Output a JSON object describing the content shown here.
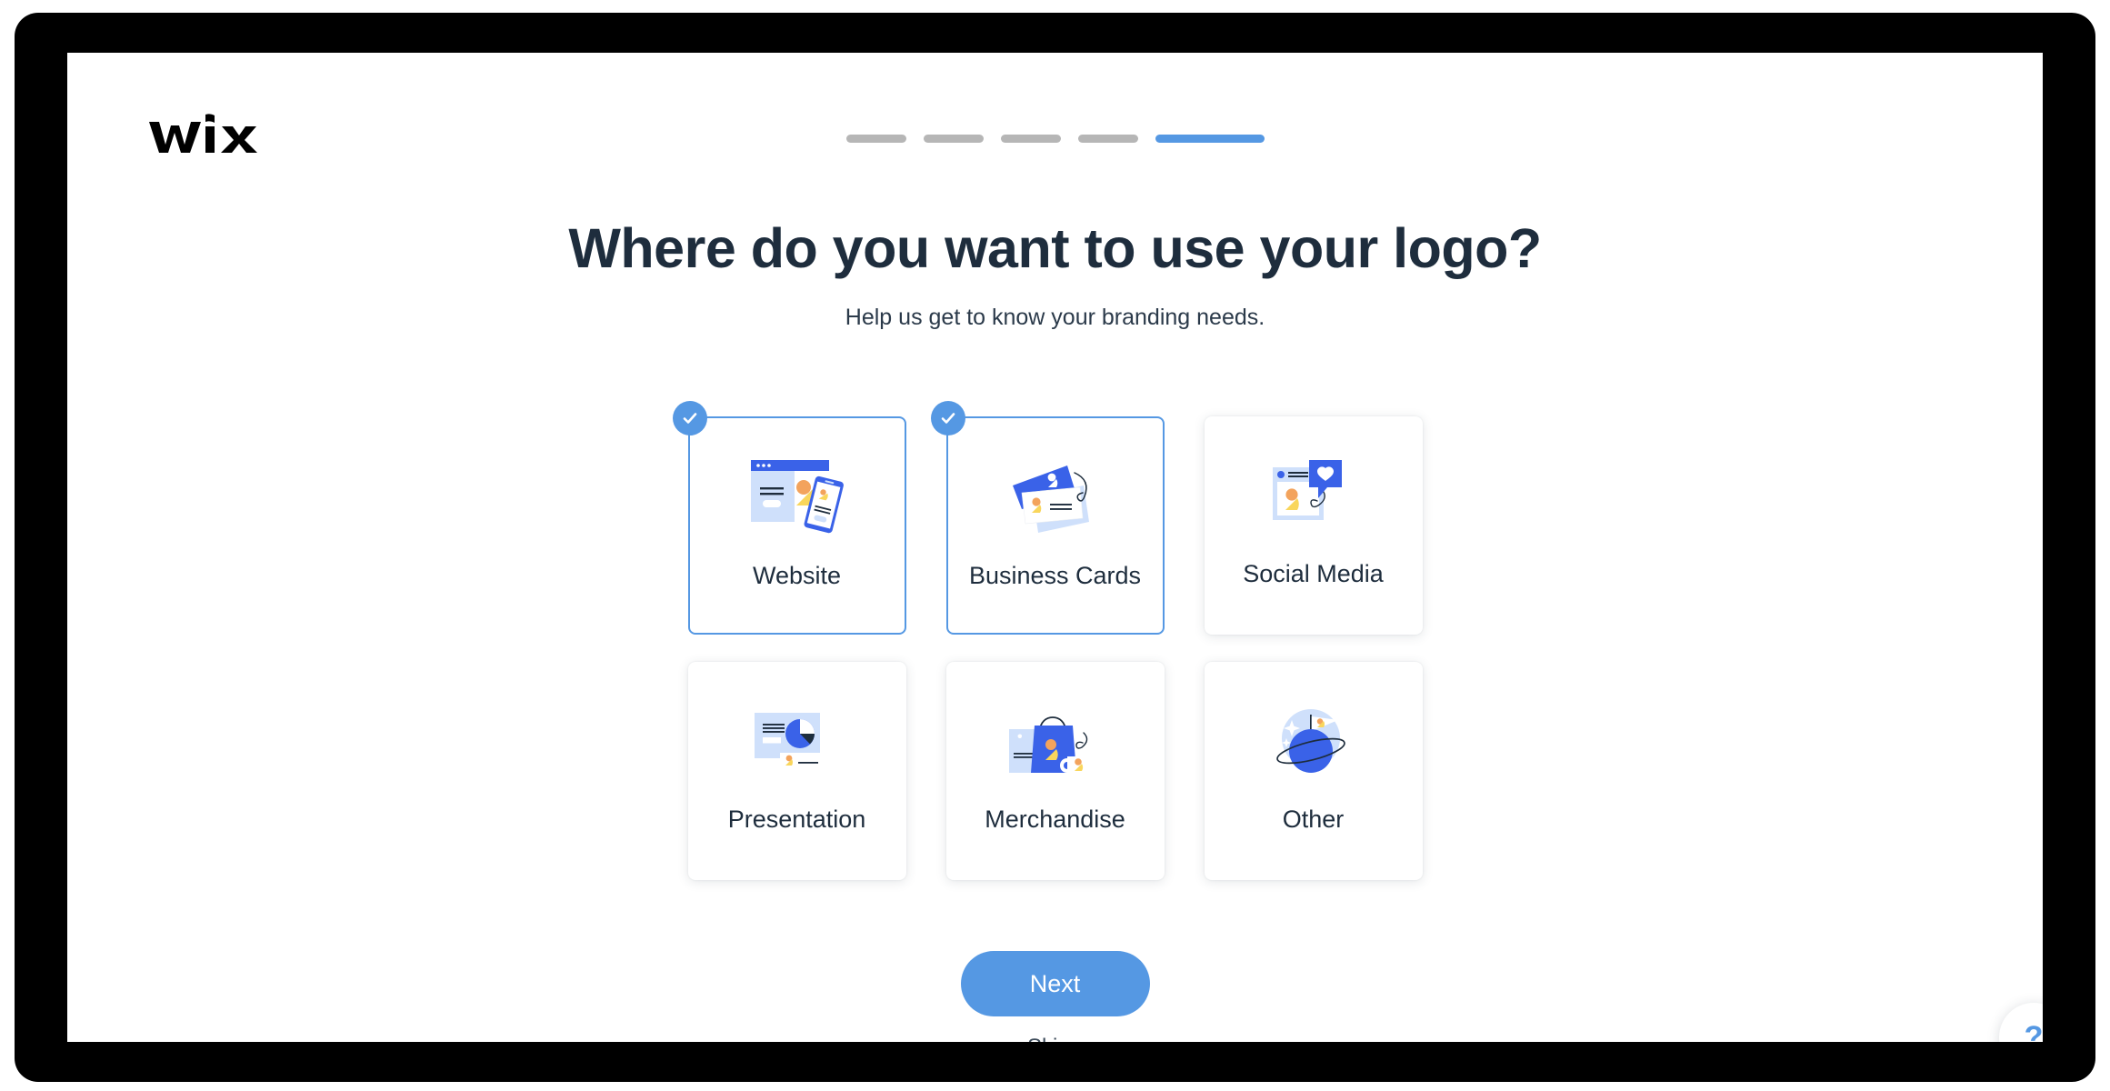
{
  "brand": {
    "logo_text": "WiX",
    "logo_icon": "wix-logo"
  },
  "progress": {
    "total_steps": 5,
    "current_step": 5,
    "steps": [
      {
        "state": "inactive"
      },
      {
        "state": "inactive"
      },
      {
        "state": "inactive"
      },
      {
        "state": "inactive"
      },
      {
        "state": "active"
      }
    ]
  },
  "header": {
    "title": "Where do you want to use your logo?",
    "subtitle": "Help us get to know your branding needs."
  },
  "options": [
    {
      "label": "Website",
      "icon": "website-illustration",
      "selected": true,
      "check_icon": "check-icon"
    },
    {
      "label": "Business Cards",
      "icon": "business-cards-illustration",
      "selected": true,
      "check_icon": "check-icon"
    },
    {
      "label": "Social Media",
      "icon": "social-media-illustration",
      "selected": false,
      "check_icon": "check-icon"
    },
    {
      "label": "Presentation",
      "icon": "presentation-illustration",
      "selected": false,
      "check_icon": "check-icon"
    },
    {
      "label": "Merchandise",
      "icon": "merchandise-illustration",
      "selected": false,
      "check_icon": "check-icon"
    },
    {
      "label": "Other",
      "icon": "other-planet-illustration",
      "selected": false,
      "check_icon": "check-icon"
    }
  ],
  "actions": {
    "next_label": "Next",
    "skip_label": "Skip",
    "skip_chevron": "›",
    "help_label": "?"
  },
  "colors": {
    "accent_blue": "#5598e3",
    "illustration_blue": "#3a62e8",
    "light_blue": "#cfe0fb",
    "yellow": "#f9d65c",
    "orange": "#f3a35c",
    "navy": "#1e2d3d",
    "step_gray": "#b6b6b6",
    "frame_black": "#000000"
  }
}
